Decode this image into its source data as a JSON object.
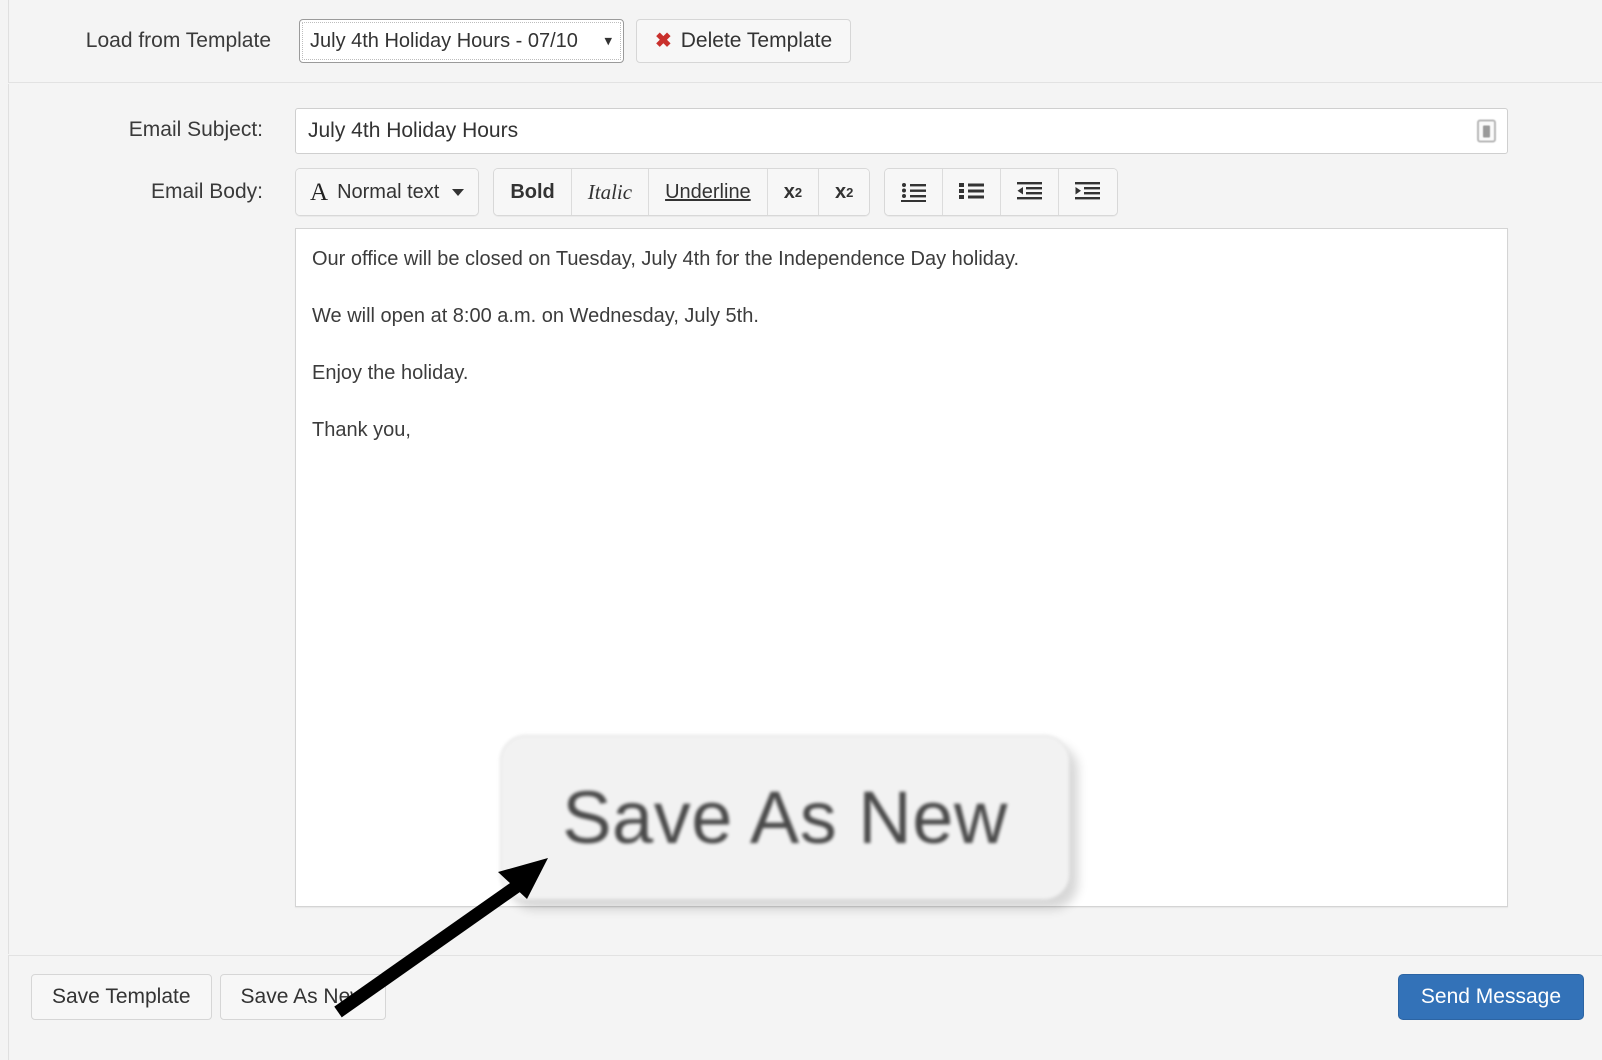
{
  "template_bar": {
    "label": "Load from Template",
    "selected_template": "July 4th Holiday Hours - 07/10",
    "template_options": [
      "July 4th Holiday Hours - 07/10"
    ],
    "delete_button": "Delete Template",
    "delete_icon": "x-mark-icon",
    "select_caret_icon": "chevron-down-icon"
  },
  "subject": {
    "label": "Email Subject:",
    "value": "July 4th Holiday Hours",
    "placeholder": "",
    "token_icon": "insert-merge-field-icon"
  },
  "body": {
    "label": "Email Body:",
    "toolbar": {
      "style_dropdown": {
        "icon": "font-style-a-icon",
        "label": "Normal text",
        "caret_icon": "caret-down-icon"
      },
      "format_buttons": [
        {
          "name": "bold",
          "label": "Bold"
        },
        {
          "name": "italic",
          "label": "Italic"
        },
        {
          "name": "underline",
          "label": "Underline"
        },
        {
          "name": "subscript",
          "label": "x2"
        },
        {
          "name": "superscript",
          "label": "x2"
        }
      ],
      "list_buttons": [
        {
          "name": "bulleted-list",
          "icon": "bulleted-list-icon"
        },
        {
          "name": "numbered-list",
          "icon": "numbered-list-icon"
        },
        {
          "name": "decrease-indent",
          "icon": "outdent-icon"
        },
        {
          "name": "increase-indent",
          "icon": "indent-icon"
        }
      ]
    },
    "paragraphs": [
      "Our office will be closed on Tuesday, July 4th for the Independence Day holiday.",
      "We will open at 8:00 a.m. on Wednesday, July 5th.",
      "Enjoy the holiday.",
      "Thank you,"
    ]
  },
  "footer": {
    "save_template_label": "Save Template",
    "save_as_new_label": "Save As New",
    "send_message_label": "Send Message"
  },
  "annotation": {
    "callout_label": "Save As New",
    "arrow_icon": "pointer-arrow-icon"
  },
  "colors": {
    "page_background": "#f4f4f4",
    "primary_button": "#3372b8",
    "delete_icon": "#c9302c",
    "text": "#3a3a3a",
    "editor_background": "#ffffff"
  }
}
